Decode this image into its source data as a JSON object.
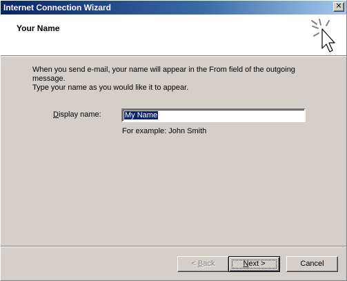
{
  "window": {
    "title": "Internet Connection Wizard",
    "close_glyph": "✕"
  },
  "header": {
    "heading": "Your Name",
    "icon": "wizard-cursor-sparkle-icon"
  },
  "body": {
    "intro_line1": "When you send e-mail, your name will appear in the From field of the outgoing message.",
    "intro_line2": "Type your name as you would like it to appear.",
    "display_name_label_accel": "D",
    "display_name_label_rest": "isplay name:",
    "display_name_value": "My Name",
    "example_text": "For example: John Smith"
  },
  "buttons": {
    "back_prefix": "< ",
    "back_accel": "B",
    "back_rest": "ack",
    "next_accel": "N",
    "next_rest": "ext >",
    "cancel": "Cancel"
  },
  "colors": {
    "title_bar_start": "#0a246a",
    "face": "#d4d0c8",
    "selection": "#0a246a"
  }
}
